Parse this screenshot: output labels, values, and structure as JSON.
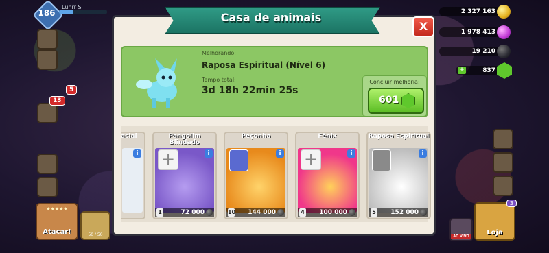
{
  "hud": {
    "level": "186",
    "player_name": "Lunrr S",
    "resources": {
      "gold": "2 327 163",
      "elixir": "1 978 413",
      "dark_elixir": "19 210",
      "gems": "837"
    },
    "badges": {
      "builders": "5",
      "chat": "13",
      "shop": "3"
    },
    "buttons": {
      "attack": "Atacar!",
      "shop": "Loja",
      "live": "AO VIVO",
      "clan": "50 / 50"
    },
    "attack_stars": "★★★★★"
  },
  "modal": {
    "title": "Casa de animais",
    "close": "X",
    "upgrade": {
      "upgrading_label": "Melhorando:",
      "pet_name": "Raposa Espiritual (Nível 6)",
      "total_time_label": "Tempo total:",
      "total_time": "3d 18h 22min 25s",
      "finish_label": "Concluir melhoria:",
      "gem_cost": "601"
    },
    "pets": [
      {
        "name": "acial",
        "level": "",
        "cost": "",
        "color": "#f0f3f6"
      },
      {
        "name": "Pangolim Blindado",
        "level": "1",
        "cost": "72 000",
        "color": "#8b6dd6"
      },
      {
        "name": "Peçonha",
        "level": "10",
        "cost": "144 000",
        "color": "#f2a02b"
      },
      {
        "name": "Fênix",
        "level": "4",
        "cost": "100 000",
        "color": "#f0378a"
      },
      {
        "name": "Raposa Espiritual",
        "level": "5",
        "cost": "152 000",
        "color": "#e4e4e4"
      }
    ]
  },
  "colors": {
    "ribbon": "#1c7464",
    "panel_green": "#8cc764",
    "close_red": "#d53a2c",
    "gem_green": "#5fc82c"
  }
}
